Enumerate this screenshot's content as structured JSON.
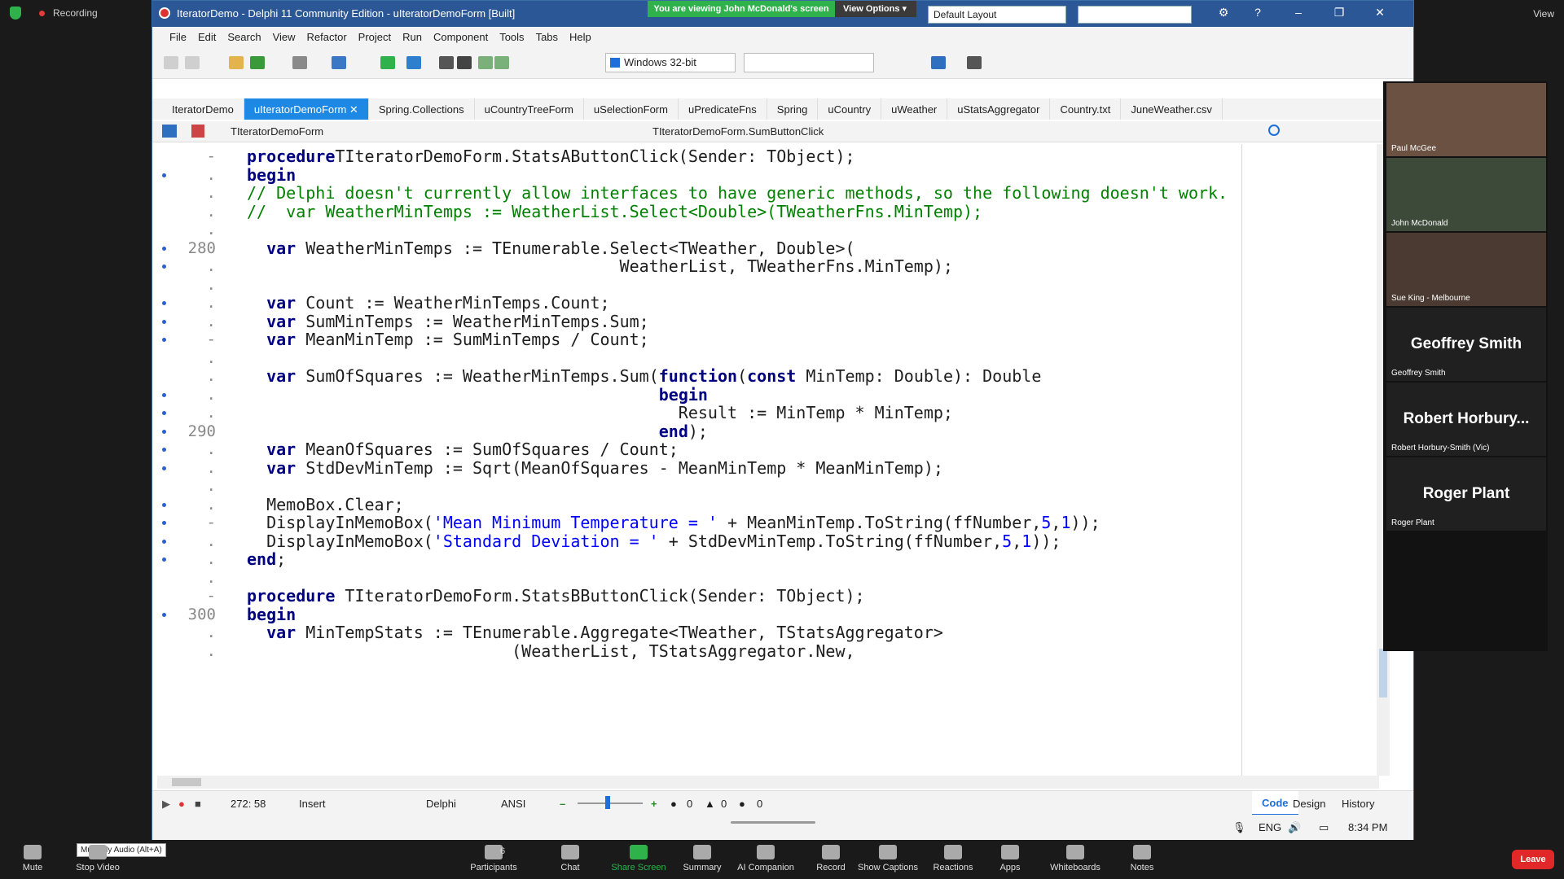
{
  "zoom": {
    "recording_label": "Recording",
    "view_label": "View",
    "sharing_banner": "You are viewing John McDonald's screen",
    "view_options": "View Options",
    "mute_tooltip": "Mute My Audio (Alt+A)",
    "participants_count": "6",
    "bottom": [
      {
        "label": "Mute"
      },
      {
        "label": "Stop Video"
      },
      {
        "label": "Participants"
      },
      {
        "label": "Chat"
      },
      {
        "label": "Share Screen"
      },
      {
        "label": "Summary"
      },
      {
        "label": "AI Companion"
      },
      {
        "label": "Record"
      },
      {
        "label": "Show Captions"
      },
      {
        "label": "Reactions"
      },
      {
        "label": "Apps"
      },
      {
        "label": "Whiteboards"
      },
      {
        "label": "Notes"
      }
    ],
    "leave": "Leave",
    "participants": [
      {
        "name": "Paul McGee",
        "big": ""
      },
      {
        "name": "John McDonald",
        "big": ""
      },
      {
        "name": "Sue King - Melbourne",
        "big": ""
      },
      {
        "name": "Geoffrey Smith",
        "big": "Geoffrey Smith"
      },
      {
        "name": "Robert Horbury-Smith (Vic)",
        "big": "Robert Horbury..."
      },
      {
        "name": "Roger Plant",
        "big": "Roger Plant"
      }
    ]
  },
  "ide": {
    "title": "IteratorDemo - Delphi 11 Community Edition - uIteratorDemoForm [Built]",
    "layout": "Default Layout",
    "menu": [
      "File",
      "Edit",
      "Search",
      "View",
      "Refactor",
      "Project",
      "Run",
      "Component",
      "Tools",
      "Tabs",
      "Help"
    ],
    "platform": "Windows 32-bit",
    "tabs": [
      "IteratorDemo",
      "uIteratorDemoForm",
      "Spring.Collections",
      "uCountryTreeForm",
      "uSelectionForm",
      "uPredicateFns",
      "Spring",
      "uCountry",
      "uWeather",
      "uStatsAggregator",
      "Country.txt",
      "JuneWeather.csv"
    ],
    "active_tab": 1,
    "nav_class": "TIteratorDemoForm",
    "nav_method": "TIteratorDemoForm.SumButtonClick",
    "status": {
      "position": "272: 58",
      "mode": "Insert",
      "language": "Delphi",
      "encoding": "ANSI",
      "counts": [
        "0",
        "0",
        "0"
      ],
      "code_tab": "Code",
      "design_tab": "Design",
      "history_tab": "History"
    },
    "tray": {
      "lang": "ENG",
      "time": "8:34 PM"
    }
  },
  "code": [
    {
      "n": "",
      "dot": false,
      "mark": "-",
      "t": [
        [
          "kw",
          "procedure"
        ],
        [
          "",
          "TIteratorDemoForm.StatsAButtonClick(Sender: TObject);"
        ]
      ]
    },
    {
      "n": "",
      "dot": true,
      "mark": ".",
      "t": [
        [
          "kw",
          "begin"
        ]
      ]
    },
    {
      "n": "",
      "dot": false,
      "mark": ".",
      "t": [
        [
          "cm",
          "// Delphi doesn't currently allow interfaces to have generic methods, so the following doesn't work."
        ]
      ]
    },
    {
      "n": "",
      "dot": false,
      "mark": ".",
      "t": [
        [
          "cm",
          "//  var WeatherMinTemps := WeatherList.Select<Double>(TWeatherFns.MinTemp);"
        ]
      ]
    },
    {
      "n": "",
      "dot": false,
      "mark": ".",
      "t": []
    },
    {
      "n": "280",
      "dot": true,
      "mark": "",
      "t": [
        [
          "",
          "  "
        ],
        [
          "kw",
          "var"
        ],
        [
          "",
          " WeatherMinTemps := TEnumerable.Select<TWeather, Double>("
        ]
      ]
    },
    {
      "n": "",
      "dot": true,
      "mark": ".",
      "t": [
        [
          "",
          "                                      WeatherList, TWeatherFns.MinTemp);"
        ]
      ]
    },
    {
      "n": "",
      "dot": false,
      "mark": ".",
      "t": []
    },
    {
      "n": "",
      "dot": true,
      "mark": ".",
      "t": [
        [
          "",
          "  "
        ],
        [
          "kw",
          "var"
        ],
        [
          "",
          " Count := WeatherMinTemps.Count;"
        ]
      ]
    },
    {
      "n": "",
      "dot": true,
      "mark": ".",
      "t": [
        [
          "",
          "  "
        ],
        [
          "kw",
          "var"
        ],
        [
          "",
          " SumMinTemps := WeatherMinTemps.Sum;"
        ]
      ]
    },
    {
      "n": "",
      "dot": true,
      "mark": "-",
      "t": [
        [
          "",
          "  "
        ],
        [
          "kw",
          "var"
        ],
        [
          "",
          " MeanMinTemp := SumMinTemps / Count;"
        ]
      ]
    },
    {
      "n": "",
      "dot": false,
      "mark": ".",
      "t": []
    },
    {
      "n": "",
      "dot": false,
      "mark": ".",
      "t": [
        [
          "",
          "  "
        ],
        [
          "kw",
          "var"
        ],
        [
          "",
          " SumOfSquares := WeatherMinTemps.Sum("
        ],
        [
          "kw",
          "function"
        ],
        [
          "",
          "("
        ],
        [
          "kw",
          "const"
        ],
        [
          "",
          " MinTemp: Double): Double"
        ]
      ]
    },
    {
      "n": "",
      "dot": true,
      "mark": ".",
      "t": [
        [
          "",
          "                                          "
        ],
        [
          "kw",
          "begin"
        ]
      ]
    },
    {
      "n": "",
      "dot": true,
      "mark": ".",
      "t": [
        [
          "",
          "                                            Result := MinTemp * MinTemp;"
        ]
      ]
    },
    {
      "n": "290",
      "dot": true,
      "mark": "",
      "t": [
        [
          "",
          "                                          "
        ],
        [
          "kw",
          "end"
        ],
        [
          "",
          ");"
        ]
      ]
    },
    {
      "n": "",
      "dot": true,
      "mark": ".",
      "t": [
        [
          "",
          "  "
        ],
        [
          "kw",
          "var"
        ],
        [
          "",
          " MeanOfSquares := SumOfSquares / Count;"
        ]
      ]
    },
    {
      "n": "",
      "dot": true,
      "mark": ".",
      "t": [
        [
          "",
          "  "
        ],
        [
          "kw",
          "var"
        ],
        [
          "",
          " StdDevMinTemp := Sqrt(MeanOfSquares - MeanMinTemp * MeanMinTemp);"
        ]
      ]
    },
    {
      "n": "",
      "dot": false,
      "mark": ".",
      "t": []
    },
    {
      "n": "",
      "dot": true,
      "mark": ".",
      "t": [
        [
          "",
          "  MemoBox.Clear;"
        ]
      ]
    },
    {
      "n": "",
      "dot": true,
      "mark": "-",
      "t": [
        [
          "",
          "  DisplayInMemoBox("
        ],
        [
          "str",
          "'Mean Minimum Temperature = '"
        ],
        [
          "",
          " + MeanMinTemp.ToString(ffNumber,"
        ],
        [
          "num",
          "5"
        ],
        [
          "",
          ","
        ],
        [
          "num",
          "1"
        ],
        [
          "",
          "));"
        ]
      ]
    },
    {
      "n": "",
      "dot": true,
      "mark": ".",
      "t": [
        [
          "",
          "  DisplayInMemoBox("
        ],
        [
          "str",
          "'Standard Deviation = '"
        ],
        [
          "",
          " + StdDevMinTemp.ToString(ffNumber,"
        ],
        [
          "num",
          "5"
        ],
        [
          "",
          ","
        ],
        [
          "num",
          "1"
        ],
        [
          "",
          "));"
        ]
      ]
    },
    {
      "n": "",
      "dot": true,
      "mark": ".",
      "t": [
        [
          "kw",
          "end"
        ],
        [
          "",
          ";"
        ]
      ]
    },
    {
      "n": "",
      "dot": false,
      "mark": ".",
      "t": []
    },
    {
      "n": "",
      "dot": false,
      "mark": "-",
      "t": [
        [
          "kw",
          "procedure"
        ],
        [
          "",
          " TIteratorDemoForm.StatsBButtonClick(Sender: TObject);"
        ]
      ]
    },
    {
      "n": "300",
      "dot": true,
      "mark": "",
      "t": [
        [
          "kw",
          "begin"
        ]
      ]
    },
    {
      "n": "",
      "dot": false,
      "mark": ".",
      "t": [
        [
          "",
          "  "
        ],
        [
          "kw",
          "var"
        ],
        [
          "",
          " MinTempStats := TEnumerable.Aggregate<TWeather, TStatsAggregator>"
        ]
      ]
    },
    {
      "n": "",
      "dot": false,
      "mark": ".",
      "t": [
        [
          "",
          "                           (WeatherList, TStatsAggregator.New,"
        ]
      ]
    }
  ]
}
